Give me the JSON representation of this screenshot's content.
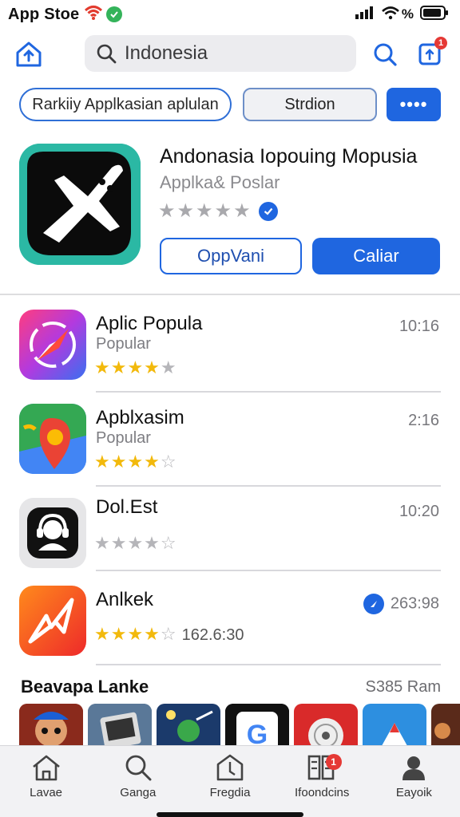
{
  "status_bar": {
    "carrier": "App Stoe",
    "battery_label": "%"
  },
  "header": {
    "search_value": "Indonesia",
    "notification_count": "1"
  },
  "filters": {
    "chip1": "Rarkiiy Applkasian aplulan",
    "chip2": "Strdion",
    "chip3": "••••"
  },
  "featured": {
    "title": "Andonasia Iopouing Mopusia",
    "subtitle": "Applka& Poslar",
    "rating_stars": 5,
    "btn_outline": "OppVani",
    "btn_solid": "Caliar"
  },
  "apps": [
    {
      "name": "Aplic Popula",
      "category": "Popular",
      "time": "10:16",
      "rating": 4,
      "extra": ""
    },
    {
      "name": "Apblxasim",
      "category": "Popular",
      "time": "2:16",
      "rating": 4,
      "extra": ""
    },
    {
      "name": "Dol.Est",
      "category": "",
      "time": "10:20",
      "rating": 0,
      "extra": ""
    },
    {
      "name": "Anlkek",
      "category": "",
      "time": "263:98",
      "rating": 4,
      "extra": "162.6:30"
    }
  ],
  "section": {
    "title": "Beavapa Lanke",
    "meta": "S385 Ram"
  },
  "tabs": [
    {
      "label": "Lavae",
      "icon": "house-icon"
    },
    {
      "label": "Ganga",
      "icon": "search-icon"
    },
    {
      "label": "Fregdia",
      "icon": "pentagon-icon"
    },
    {
      "label": "Ifoondcins",
      "icon": "grid-icon",
      "badge": "1"
    },
    {
      "label": "Eayoik",
      "icon": "person-icon"
    }
  ],
  "colors": {
    "accent": "#1f66e0",
    "star": "#f2b90c",
    "badge": "#e53935"
  }
}
